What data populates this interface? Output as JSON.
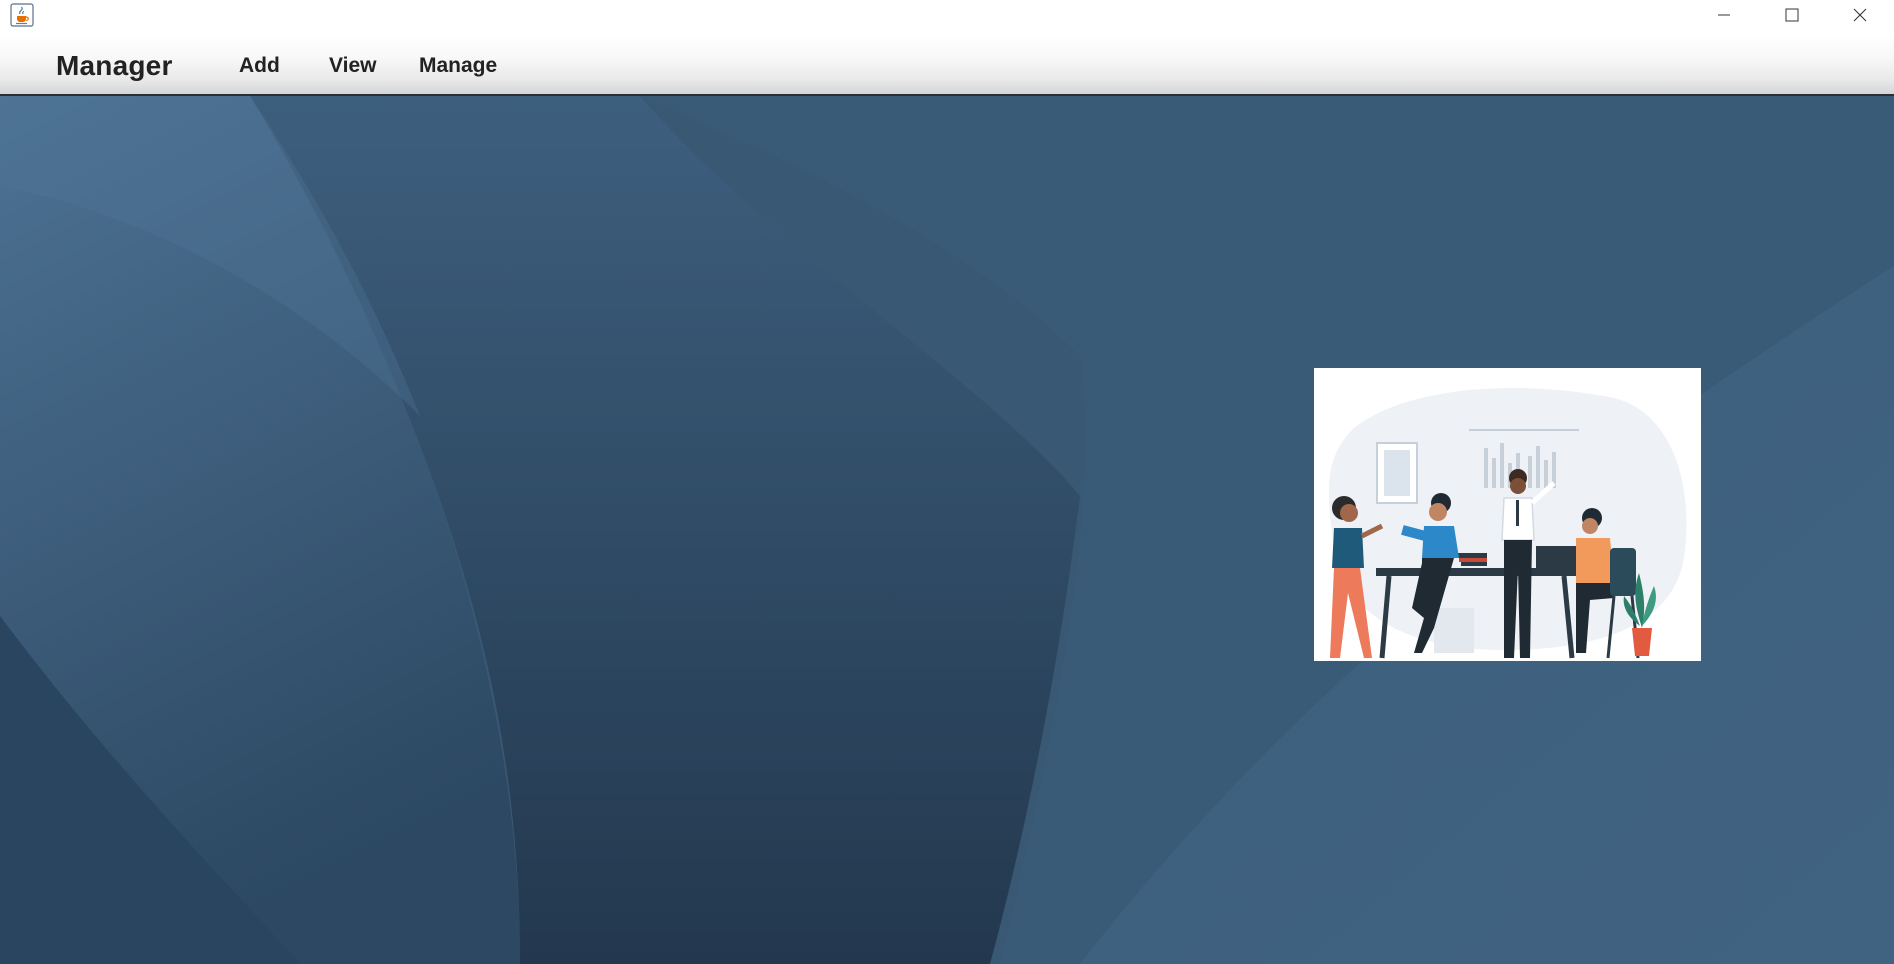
{
  "window": {
    "app_icon": "java-cup-icon",
    "controls": {
      "minimize_icon": "minimize-icon",
      "maximize_icon": "maximize-icon",
      "close_icon": "close-icon"
    }
  },
  "menubar": {
    "brand": "Manager",
    "items": [
      {
        "label": "Add"
      },
      {
        "label": "View"
      },
      {
        "label": "Manage"
      }
    ]
  },
  "content": {
    "background_colors": [
      "#4a6d8e",
      "#3a5a76",
      "#2a4660",
      "#24394f"
    ],
    "illustration": "team-meeting-illustration"
  }
}
